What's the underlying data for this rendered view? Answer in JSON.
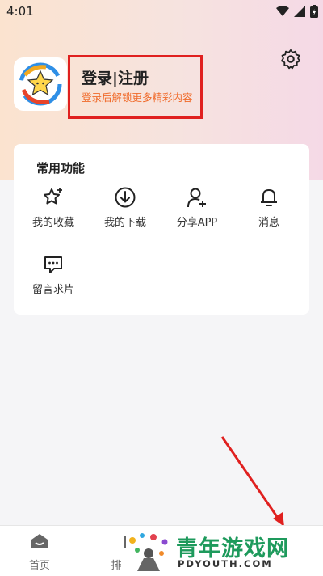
{
  "status_bar": {
    "time": "4:01"
  },
  "profile": {
    "login_title": "登录|注册",
    "login_subtitle": "登录后解锁更多精彩内容"
  },
  "common_functions": {
    "title": "常用功能",
    "items": [
      {
        "label": "我的收藏",
        "icon": "star-sparkle-icon"
      },
      {
        "label": "我的下载",
        "icon": "download-icon"
      },
      {
        "label": "分享APP",
        "icon": "share-user-icon"
      },
      {
        "label": "消息",
        "icon": "bell-icon"
      },
      {
        "label": "留言求片",
        "icon": "message-icon"
      }
    ]
  },
  "tabbar": {
    "items": [
      {
        "label": "首页",
        "icon": "home-icon"
      },
      {
        "label": "排",
        "icon": "ranking-icon"
      }
    ]
  },
  "watermark": {
    "text_cn": "青年游戏网",
    "text_en": "PDYOUTH.COM"
  },
  "colors": {
    "highlight_box": "#e0201f",
    "subtitle": "#f06a2a",
    "watermark_green": "#1e9a5c"
  }
}
